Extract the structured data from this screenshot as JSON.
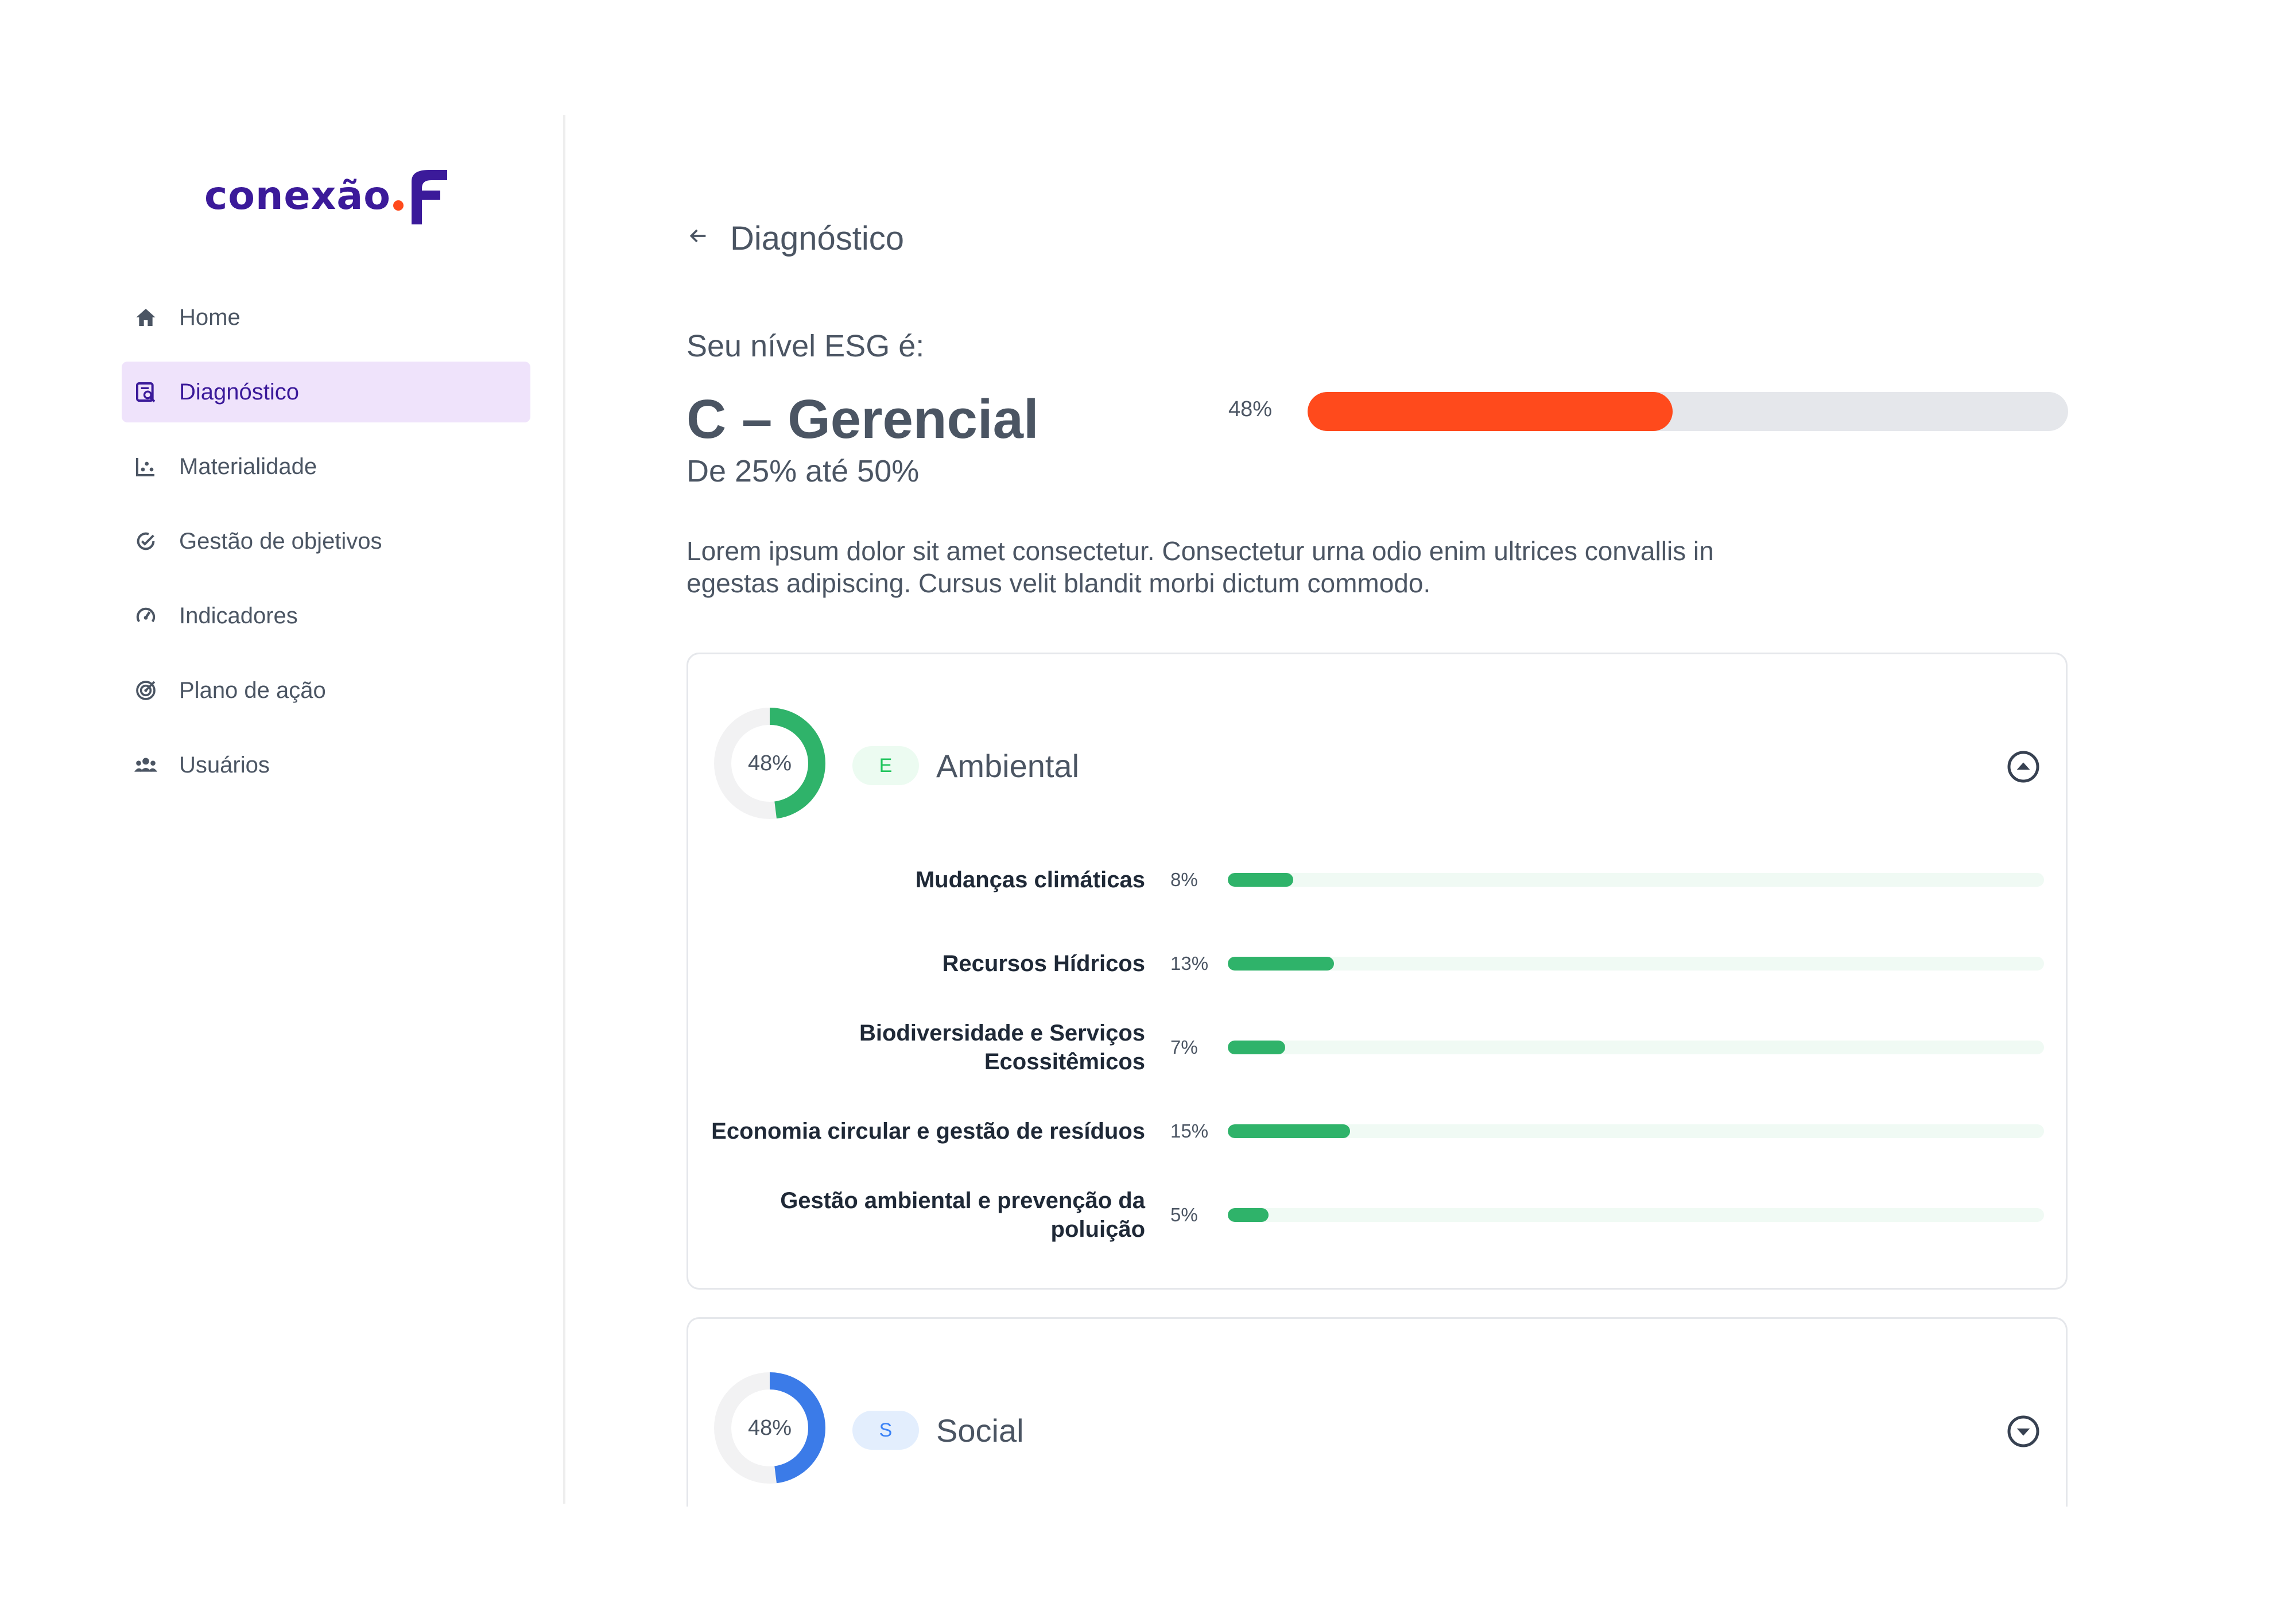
{
  "brand": {
    "logo_text": "conexão",
    "accent": "#ff4a1c",
    "primary": "#3b1a9a"
  },
  "sidebar": {
    "items": [
      {
        "label": "Home",
        "icon": "home-icon",
        "active": false
      },
      {
        "label": "Diagnóstico",
        "icon": "diagnostic-icon",
        "active": true
      },
      {
        "label": "Materialidade",
        "icon": "chart-icon",
        "active": false
      },
      {
        "label": "Gestão de objetivos",
        "icon": "check-circle-icon",
        "active": false
      },
      {
        "label": "Indicadores",
        "icon": "gauge-icon",
        "active": false
      },
      {
        "label": "Plano de ação",
        "icon": "target-icon",
        "active": false
      },
      {
        "label": "Usuários",
        "icon": "users-icon",
        "active": false
      }
    ]
  },
  "header": {
    "title": "Diagnóstico"
  },
  "level": {
    "label": "Seu nível ESG é:",
    "name": "C – Gerencial",
    "range": "De 25% até 50%",
    "percent_text": "48%",
    "percent": 0.48,
    "bar_color": "#ff4a1c"
  },
  "description": "Lorem ipsum dolor sit amet consectetur. Consectetur urna odio enim ultrices convallis in egestas adipiscing. Cursus velit blandit morbi dictum commodo.",
  "categories": [
    {
      "letter": "E",
      "name": "Ambiental",
      "percent_text": "48%",
      "percent": 0.48,
      "color": "#2fb36a",
      "expanded": true,
      "metrics": [
        {
          "label": "Mudanças climáticas",
          "percent_text": "8%",
          "percent": 0.08
        },
        {
          "label": "Recursos Hídricos",
          "percent_text": "13%",
          "percent": 0.13
        },
        {
          "label": "Biodiversidade e Serviços Ecossitêmicos",
          "percent_text": "7%",
          "percent": 0.07
        },
        {
          "label": "Economia circular e gestão de resíduos",
          "percent_text": "15%",
          "percent": 0.15
        },
        {
          "label": "Gestão ambiental e prevenção da poluição",
          "percent_text": "5%",
          "percent": 0.05
        }
      ]
    },
    {
      "letter": "S",
      "name": "Social",
      "percent_text": "48%",
      "percent": 0.48,
      "color": "#3b7be8",
      "expanded": false,
      "metrics": []
    }
  ]
}
